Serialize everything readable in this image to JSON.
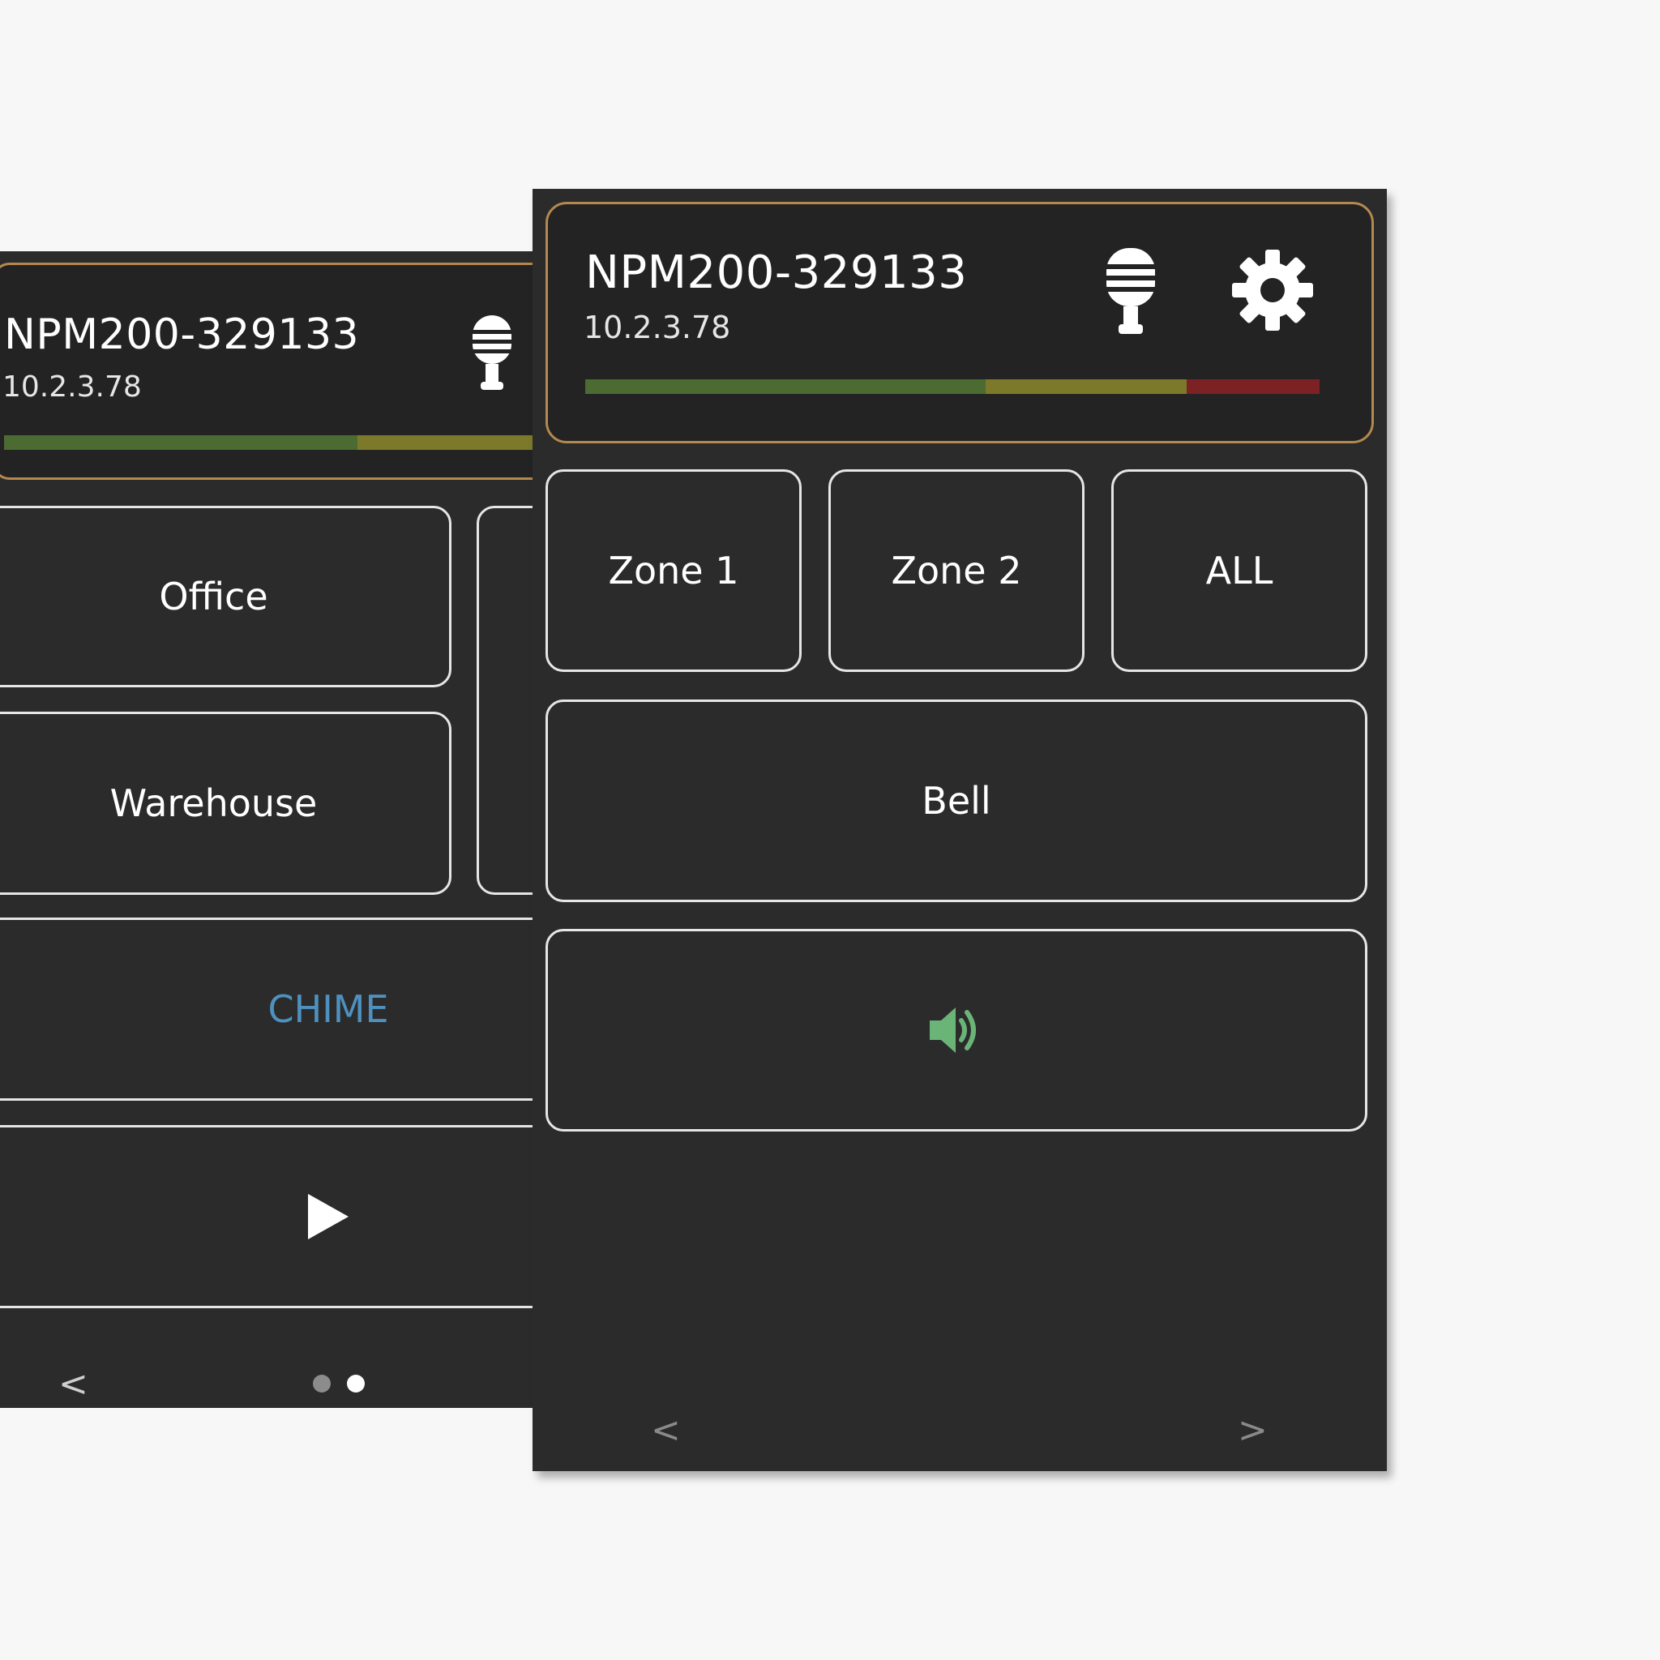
{
  "back_screen": {
    "device_name": "NPM200-329133",
    "ip_address": "10.2.3.78",
    "buttons": {
      "office": "Office",
      "warehouse": "Warehouse",
      "chime": "CHIME"
    },
    "nav": {
      "prev": "<"
    },
    "page_indicator": {
      "pages": 2,
      "current": 2
    }
  },
  "front_screen": {
    "device_name": "NPM200-329133",
    "ip_address": "10.2.3.78",
    "zones": [
      "Zone 1",
      "Zone 2",
      "ALL"
    ],
    "bell_label": "Bell",
    "nav": {
      "prev": "<",
      "next": ">"
    }
  },
  "colors": {
    "accent_border": "#b3894e",
    "meter_green": "#4b6b33",
    "meter_yellow": "#7c7a2a",
    "meter_red": "#7d2224",
    "chime_text": "#4f90bf",
    "speaker_icon": "#6ab478"
  },
  "icons": [
    "microphone-icon",
    "gear-icon",
    "speaker-icon",
    "play-icon"
  ]
}
